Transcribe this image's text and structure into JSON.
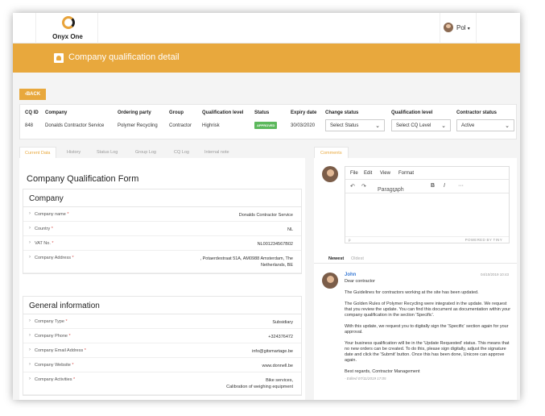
{
  "header": {
    "logo_text": "Onyx One",
    "user_name": "Pol",
    "user_caret": "▾"
  },
  "page": {
    "title": "Company qualification detail",
    "back_label": "BACK",
    "back_icon": "‹"
  },
  "summary": {
    "headers": [
      "CQ ID",
      "Company",
      "Ordering party",
      "Group",
      "Qualification level",
      "Status",
      "Expiry date",
      "Change status",
      "Qualification level",
      "Contractor status"
    ],
    "values": {
      "cq_id": "848",
      "company": "Donalds Contractor Service",
      "ordering_party": "Polymer Recycling",
      "group": "Contractor",
      "qualification_level": "Highrisk",
      "status": "APPROVED",
      "expiry_date": "30/03/2020"
    },
    "selects": {
      "change_status": "Select Status",
      "qualification_level": "Select CQ Level",
      "contractor_status": "Active"
    },
    "colors": {
      "status_badge": "#5cb85c"
    }
  },
  "tabs": [
    "Current Data",
    "History",
    "Status Log",
    "Group Log",
    "CQ Log",
    "Internal note"
  ],
  "form": {
    "title": "Company Qualification Form",
    "company_section": {
      "title": "Company",
      "rows": [
        {
          "label": "Company name",
          "value": "Donalds Contractor Service"
        },
        {
          "label": "Country",
          "value": "NL"
        },
        {
          "label": "VAT No.",
          "value": "NL001234567B02"
        },
        {
          "label": "Company Address",
          "value_lines": [
            ", Potaerdestraat 51A, AM0988 Amsterdam, The",
            "Netherlands, BE"
          ]
        }
      ]
    },
    "general_section": {
      "title": "General information",
      "rows": [
        {
          "label": "Company Type",
          "value": "Subsidiary"
        },
        {
          "label": "Company Phone",
          "value": "+324376472"
        },
        {
          "label": "Company Email Address",
          "value": "info@gitsmartage.be"
        },
        {
          "label": "Company Website",
          "value": "www.donnell.be"
        },
        {
          "label": "Company Activities",
          "value_lines": [
            "Bike services,",
            "Calibration of weighing equipment"
          ]
        }
      ]
    }
  },
  "comments": {
    "tab_label": "Comments",
    "editor": {
      "menu": [
        "File",
        "Edit",
        "View",
        "Format"
      ],
      "paragraph_label": "Paragraph",
      "bold": "B",
      "italic": "I",
      "more": "···",
      "undo": "↶",
      "redo": "↷",
      "caret": "⌄",
      "path": "p",
      "powered_by": "POWERED BY TINY"
    },
    "sort_tabs": [
      "Newest",
      "Oldest"
    ],
    "comment": {
      "author": "John",
      "date": "04/10/2019 10:43",
      "paragraphs": [
        "Dear contractor",
        "The Guidelines for contractors working at the site has been updated.",
        "The Golden Rules of Polymer Recycling were integrated in the update. We request that you review the update. You can find this document as documentation within your company qualification in the section 'Specific'.",
        "With this update, we request you to digitally sign the 'Specific' section again for your approval.",
        "Your business qualification will be in the 'Update Requested' status. This means that no new orders can be created. To do this, please sign digitally, adjust the signature date and click the 'Submit' button. Once this has been done, Unicore can approve again.",
        "Best regards, Contractor Management"
      ],
      "edited": "- Edited 07/11/2019 17:05"
    }
  }
}
